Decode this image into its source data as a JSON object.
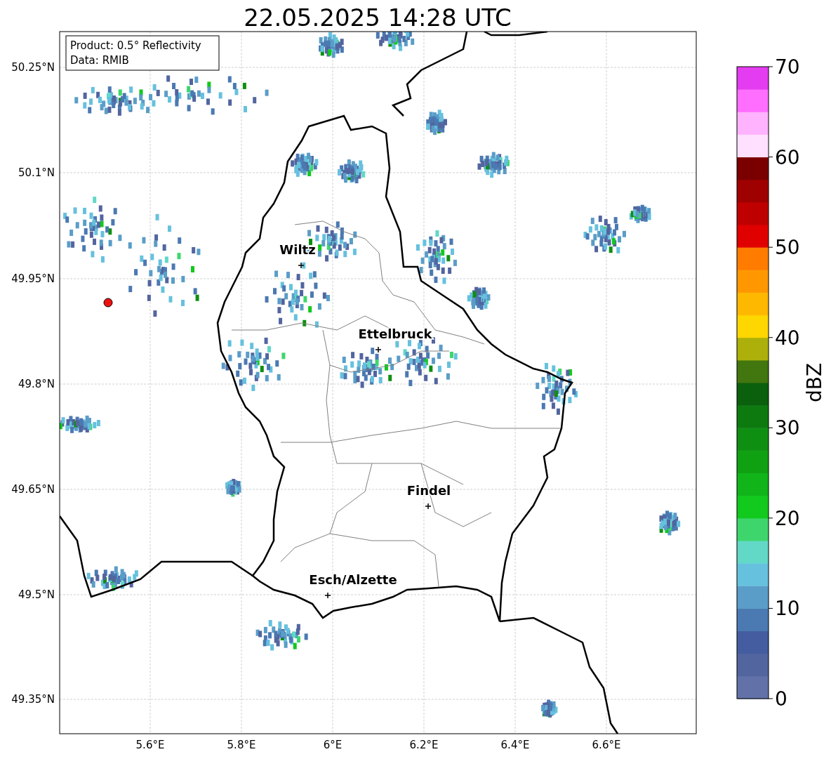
{
  "title": "22.05.2025 14:28 UTC",
  "info_box": [
    "Product: 0.5° Reflectivity",
    "Data: RMIB"
  ],
  "y_ticks": [
    "50.25°N",
    "50.1°N",
    "49.95°N",
    "49.8°N",
    "49.65°N",
    "49.5°N",
    "49.35°N"
  ],
  "x_ticks": [
    "5.6°E",
    "5.8°E",
    "6°E",
    "6.2°E",
    "6.4°E",
    "6.6°E"
  ],
  "cities": [
    {
      "name": "Wiltz"
    },
    {
      "name": "Ettelbruck"
    },
    {
      "name": "Findel"
    },
    {
      "name": "Esch/Alzette"
    }
  ],
  "colorbar": {
    "label": "dBZ",
    "ticks": [
      "70",
      "60",
      "50",
      "40",
      "30",
      "20",
      "10",
      "0"
    ],
    "bands": [
      {
        "color": "#6272a8"
      },
      {
        "color": "#52659f"
      },
      {
        "color": "#445da0"
      },
      {
        "color": "#4b79b2"
      },
      {
        "color": "#5a9dc8"
      },
      {
        "color": "#66c1de"
      },
      {
        "color": "#62d8c7"
      },
      {
        "color": "#3ed66c"
      },
      {
        "color": "#12c91d"
      },
      {
        "color": "#11b51a"
      },
      {
        "color": "#10a113"
      },
      {
        "color": "#0f8f12"
      },
      {
        "color": "#0d7a0f"
      },
      {
        "color": "#0a600d"
      },
      {
        "color": "#42760e"
      },
      {
        "color": "#adb00a"
      },
      {
        "color": "#fed600"
      },
      {
        "color": "#ffb800"
      },
      {
        "color": "#ff9800"
      },
      {
        "color": "#ff7c00"
      },
      {
        "color": "#e00000"
      },
      {
        "color": "#bf0000"
      },
      {
        "color": "#9f0000"
      },
      {
        "color": "#7a0000"
      },
      {
        "color": "#ffe0ff"
      },
      {
        "color": "#ffb3ff"
      },
      {
        "color": "#ff6eff"
      },
      {
        "color": "#e43cf0"
      }
    ]
  }
}
